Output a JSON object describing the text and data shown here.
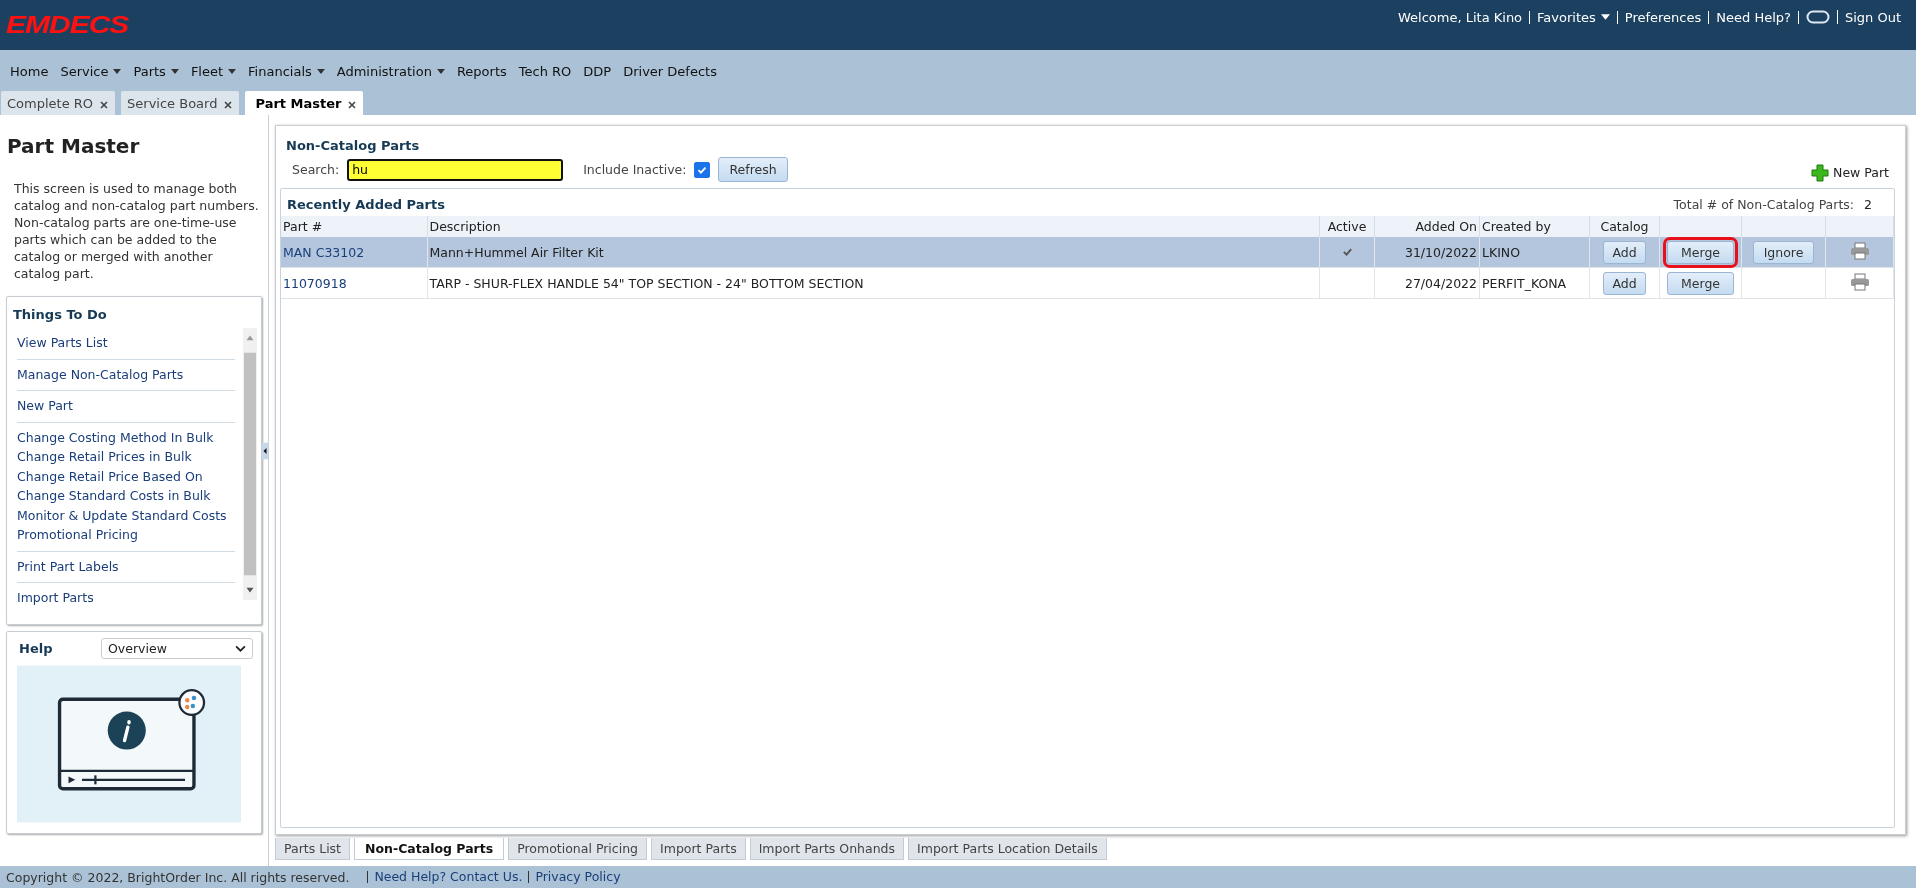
{
  "header": {
    "logo": "EMDECS",
    "welcome": "Welcome, Lita Kino",
    "links": [
      {
        "label": "Favorites",
        "dropdown": true
      },
      {
        "label": "Preferences",
        "dropdown": false
      },
      {
        "label": "Need Help?",
        "dropdown": false
      }
    ],
    "sign_out": "Sign Out"
  },
  "menu": [
    {
      "label": "Home",
      "dropdown": false
    },
    {
      "label": "Service",
      "dropdown": true
    },
    {
      "label": "Parts",
      "dropdown": true
    },
    {
      "label": "Fleet",
      "dropdown": true
    },
    {
      "label": "Financials",
      "dropdown": true
    },
    {
      "label": "Administration",
      "dropdown": true
    },
    {
      "label": "Reports",
      "dropdown": false
    },
    {
      "label": "Tech RO",
      "dropdown": false
    },
    {
      "label": "DDP",
      "dropdown": false
    },
    {
      "label": "Driver Defects",
      "dropdown": false
    }
  ],
  "tabs": [
    {
      "label": "Complete RO",
      "selected": false
    },
    {
      "label": "Service Board",
      "selected": false
    },
    {
      "label": "Part Master",
      "selected": true
    }
  ],
  "sidebar": {
    "title": "Part Master",
    "description": "This screen is used to manage both catalog and non-catalog part numbers. Non-catalog parts are one-time-use parts which can be added to the catalog or merged with another catalog part.",
    "things_to_do": {
      "title": "Things To Do",
      "groups": [
        [
          "View Parts List"
        ],
        [
          "Manage Non-Catalog Parts"
        ],
        [
          "New Part"
        ],
        [
          "Change Costing Method In Bulk",
          "Change Retail Prices in Bulk",
          "Change Retail Price Based On",
          "Change Standard Costs in Bulk",
          "Monitor & Update Standard Costs",
          "Promotional Pricing"
        ],
        [
          "Print Part Labels"
        ],
        [
          "Import Parts"
        ]
      ]
    },
    "help": {
      "title": "Help",
      "selected_topic": "Overview"
    }
  },
  "panel": {
    "title": "Non-Catalog Parts",
    "search_label": "Search:",
    "search_value": "hu",
    "include_inactive_label": "Include Inactive:",
    "include_inactive": true,
    "refresh": "Refresh",
    "new_part": "New Part",
    "section_title": "Recently Added Parts",
    "total_label": "Total # of Non-Catalog Parts:",
    "total": "2",
    "columns": [
      "Part #",
      "Description",
      "Active",
      "Added On",
      "Created by",
      "Catalog"
    ],
    "rows": [
      {
        "part": "MAN C33102",
        "description": "Mann+Hummel Air Filter Kit",
        "active": true,
        "added_on": "31/10/2022",
        "created_by": "LKINO",
        "add": "Add",
        "merge": "Merge",
        "merge_highlighted": true,
        "ignore": "Ignore",
        "selected": true
      },
      {
        "part": "11070918",
        "description": "TARP - SHUR-FLEX HANDLE 54\" TOP SECTION - 24\" BOTTOM SECTION",
        "active": false,
        "added_on": "27/04/2022",
        "created_by": "PERFIT_KONA",
        "add": "Add",
        "merge": "Merge",
        "merge_highlighted": false,
        "selected": false
      }
    ]
  },
  "bottom_tabs": [
    {
      "label": "Parts List",
      "selected": false
    },
    {
      "label": "Non-Catalog Parts",
      "selected": true
    },
    {
      "label": "Promotional Pricing",
      "selected": false
    },
    {
      "label": "Import Parts",
      "selected": false
    },
    {
      "label": "Import Parts Onhands",
      "selected": false
    },
    {
      "label": "Import Parts Location Details",
      "selected": false
    }
  ],
  "footer": {
    "copyright": "Copyright © 2022, BrightOrder Inc. All rights reserved.",
    "links": [
      "Need Help? Contact Us.",
      "Privacy Policy"
    ]
  }
}
